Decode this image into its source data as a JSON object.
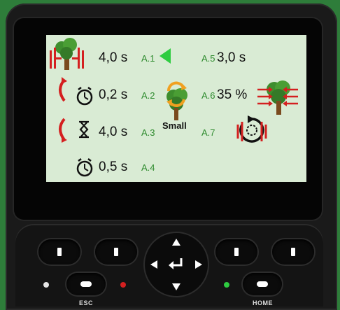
{
  "screen": {
    "rows": [
      {
        "time": "4,0 s",
        "id": "A.1"
      },
      {
        "time": "0,2 s",
        "id": "A.2"
      },
      {
        "time": "4,0 s",
        "id": "A.3"
      },
      {
        "time": "0,5 s",
        "id": "A.4"
      }
    ],
    "right": [
      {
        "id": "A.5",
        "value": "3,0 s"
      },
      {
        "id": "A.6",
        "value": "35 %"
      },
      {
        "id": "A.7",
        "value": ""
      }
    ],
    "tree_size_label": "Small"
  },
  "keypad": {
    "esc_label": "ESC",
    "home_label": "HOME"
  },
  "colors": {
    "screen_bg": "#d9ebd4",
    "param_id": "#2e8b2e",
    "accent_red": "#d42020",
    "accent_green": "#2ecc40",
    "accent_orange": "#f0a020",
    "tree_green": "#3e8e2e",
    "trunk_brown": "#7a4a1e"
  },
  "icons": [
    "tree-clamp-icon",
    "arrow-left-green-icon",
    "curved-red-arrow-icon",
    "stopwatch-icon",
    "hourglass-icon",
    "tree-rotate-icon",
    "tree-push-arrows-icon",
    "rotate-cycle-icon"
  ]
}
